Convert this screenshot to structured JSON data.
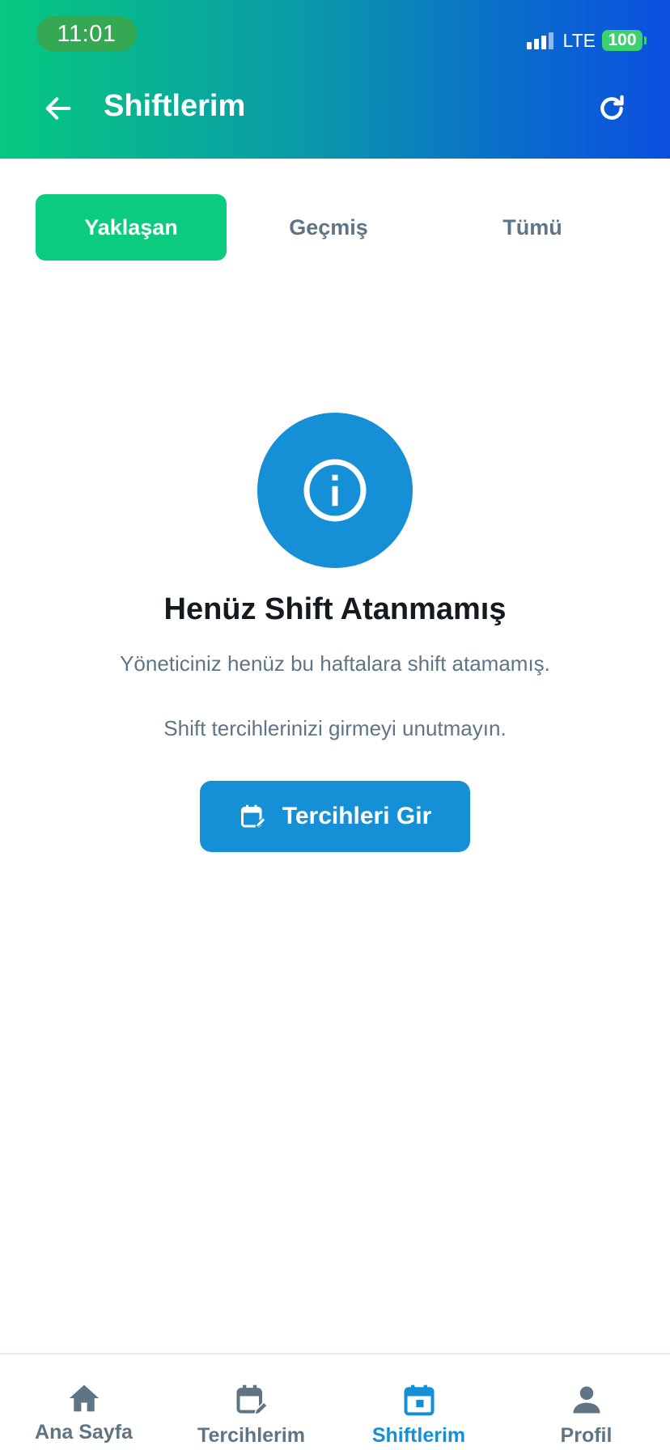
{
  "status_bar": {
    "time": "11:01",
    "network": "LTE",
    "battery": "100"
  },
  "header": {
    "title": "Shiftlerim",
    "back_icon": "arrow-left-icon",
    "refresh_icon": "refresh-icon",
    "gradient_colors": [
      "#06c97f",
      "#0b4fe0"
    ]
  },
  "tabs": [
    {
      "label": "Yaklaşan",
      "active": true
    },
    {
      "label": "Geçmiş",
      "active": false
    },
    {
      "label": "Tümü",
      "active": false
    }
  ],
  "empty_state": {
    "icon": "info-icon",
    "title": "Henüz Shift Atanmamış",
    "description": "Yöneticiniz henüz bu haftalara shift atamamış.",
    "note": "Shift tercihlerinizi girmeyi unutmayın.",
    "button_label": "Tercihleri Gir",
    "button_icon": "calendar-edit-icon"
  },
  "bottom_nav": [
    {
      "label": "Ana Sayfa",
      "icon": "home-icon",
      "active": false
    },
    {
      "label": "Tercihlerim",
      "icon": "calendar-edit-icon",
      "active": false
    },
    {
      "label": "Shiftlerim",
      "icon": "calendar-icon",
      "active": true
    },
    {
      "label": "Profil",
      "icon": "person-icon",
      "active": false
    }
  ],
  "colors": {
    "accent_green": "#0bcb80",
    "accent_blue": "#1590d6",
    "text_muted": "#5f7585",
    "text_dark": "#141a1f"
  }
}
